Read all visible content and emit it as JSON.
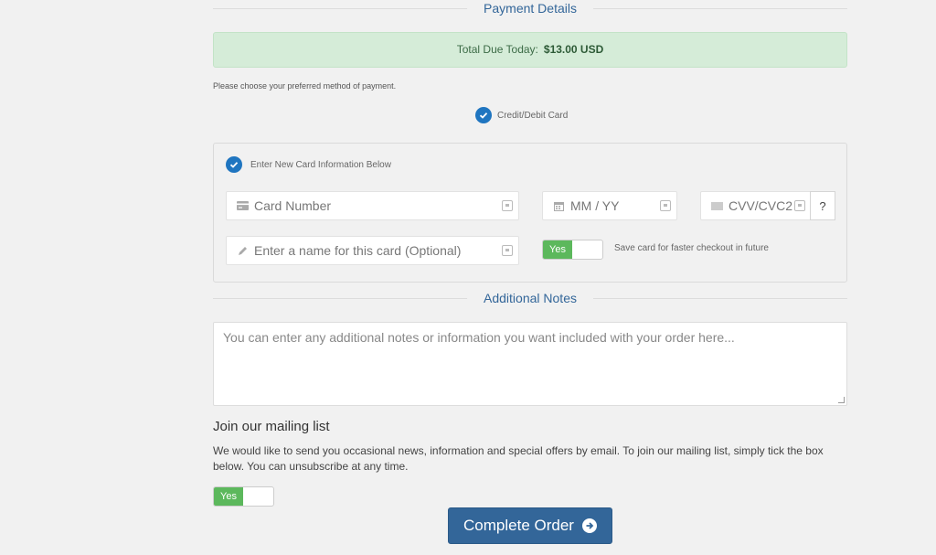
{
  "payment": {
    "section_title": "Payment Details",
    "total_label": "Total Due Today:",
    "total_value": "$13.00 USD",
    "choose_hint": "Please choose your preferred method of payment.",
    "method_label": "Credit/Debit Card",
    "new_card_label": "Enter New Card Information Below",
    "card_number_placeholder": "Card Number",
    "expiry_placeholder": "MM / YY",
    "cvv_placeholder": "CVV/CVC2",
    "cvv_help": "?",
    "card_name_placeholder": "Enter a name for this card (Optional)",
    "save_toggle_label": "Yes",
    "save_card_text": "Save card for faster checkout in future"
  },
  "notes": {
    "section_title": "Additional Notes",
    "placeholder": "You can enter any additional notes or information you want included with your order here..."
  },
  "mailing": {
    "heading": "Join our mailing list",
    "text": "We would like to send you occasional news, information and special offers by email. To join our mailing list, simply tick the box below. You can unsubscribe at any time.",
    "toggle_label": "Yes"
  },
  "actions": {
    "complete_order": "Complete Order"
  },
  "colors": {
    "accent": "#336699",
    "success": "#5cb85c",
    "check": "#1f75c0",
    "total_bg": "#d5ecd8"
  }
}
